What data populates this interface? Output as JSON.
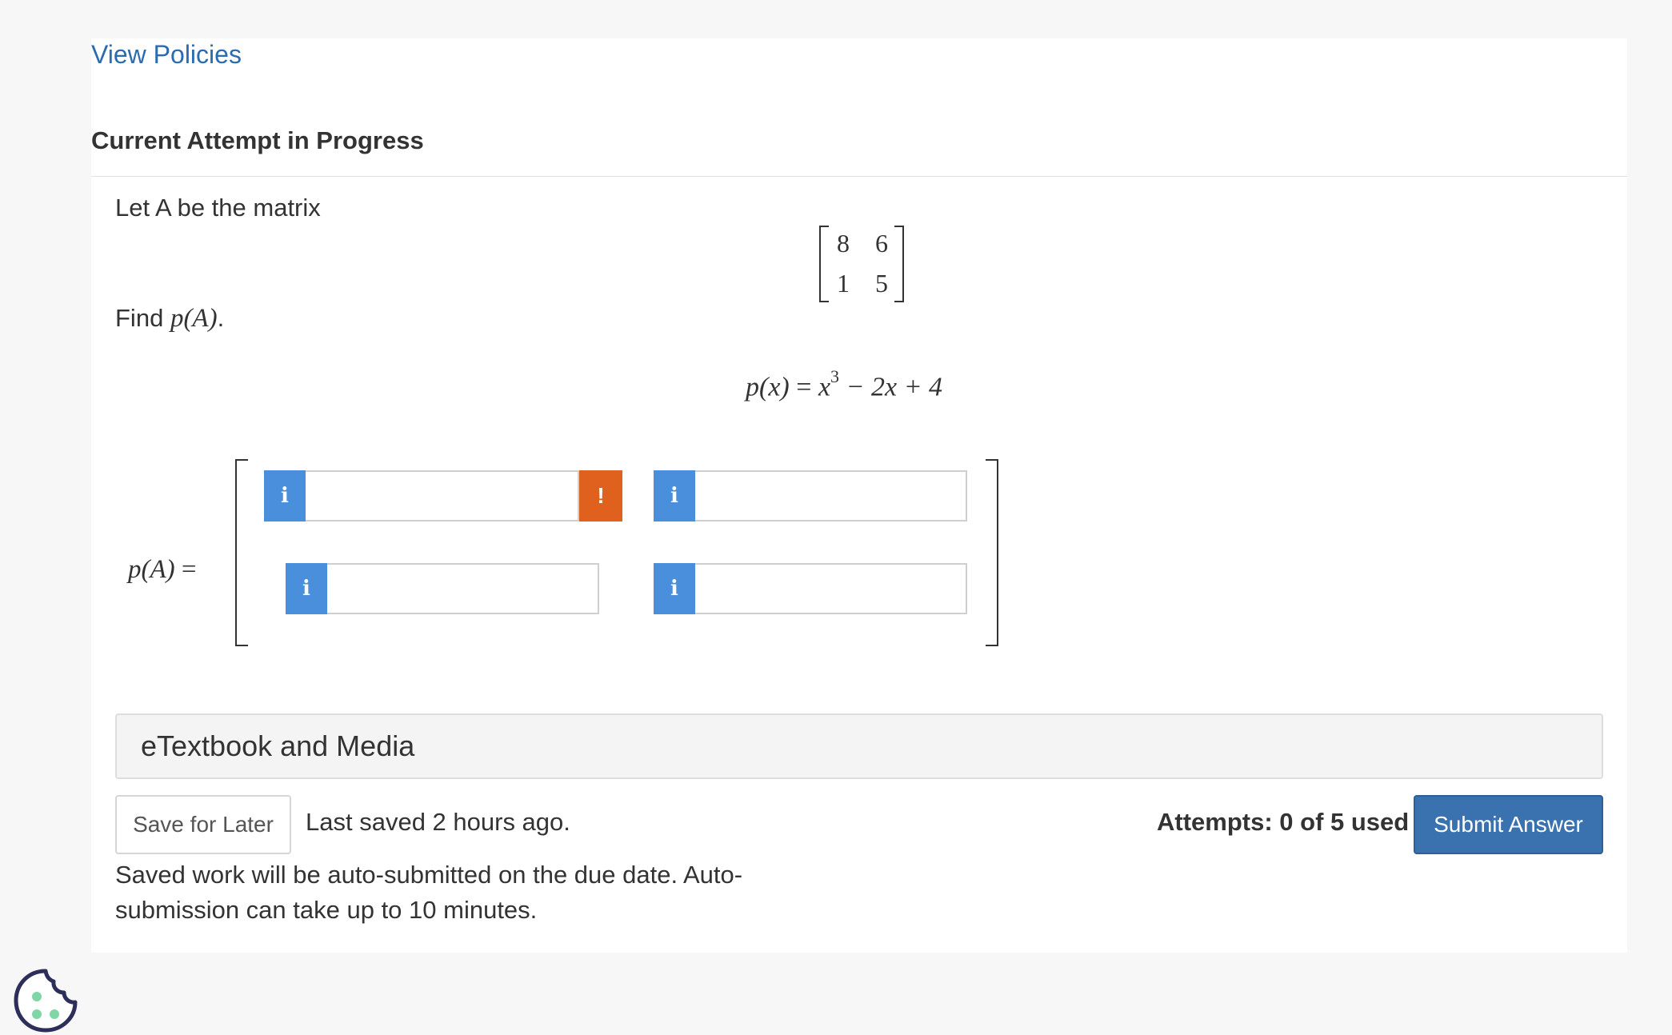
{
  "header": {
    "view_policies": "View Policies",
    "attempt_title": "Current Attempt in Progress"
  },
  "question": {
    "intro": "Let A be the matrix",
    "matrix": [
      [
        "8",
        "6"
      ],
      [
        "1",
        "5"
      ]
    ],
    "find": "Find",
    "find_expr": "p(A)",
    "find_end": ".",
    "poly": {
      "lhs": "p(x)",
      "eq": "=",
      "x": "x",
      "exp": "3",
      "rest": "− 2x + 4"
    }
  },
  "answer": {
    "label": "p(A)",
    "eq": "=",
    "info_glyph": "i",
    "warn_glyph": "!",
    "cells": [
      {
        "id": "a11",
        "value": ""
      },
      {
        "id": "a12",
        "value": ""
      },
      {
        "id": "a21",
        "value": ""
      },
      {
        "id": "a22",
        "value": ""
      }
    ]
  },
  "resources": {
    "etextbook": "eTextbook and Media"
  },
  "footer": {
    "save_label": "Save for Later",
    "last_saved": "Last saved 2 hours ago.",
    "auto_note": "Saved work will be auto-submitted on the due date. Auto-submission can take up to 10 minutes.",
    "attempts": "Attempts: 0 of 5 used",
    "submit_label": "Submit Answer"
  },
  "colors": {
    "link": "#2b6cb0",
    "info_button": "#4a8fdc",
    "warning_button": "#e0601e",
    "submit_button": "#3a72b0",
    "cookie_outline": "#2d2f5a",
    "cookie_dots": "#7ed7a4"
  },
  "icons": {
    "cookie": "cookie-icon",
    "info": "info-icon",
    "warning": "exclamation-icon"
  }
}
